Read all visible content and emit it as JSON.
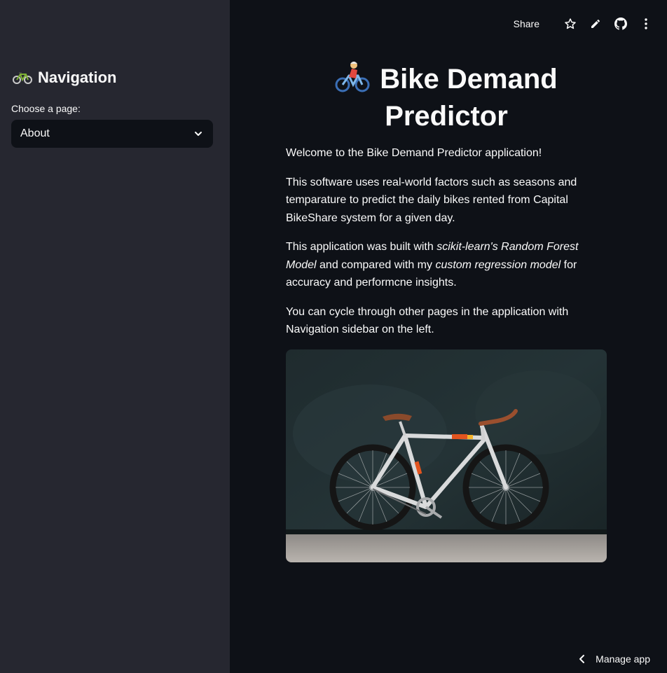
{
  "sidebar": {
    "title": "Navigation",
    "title_icon": "bicycle-icon",
    "select_label": "Choose a page:",
    "select_value": "About"
  },
  "toolbar": {
    "share_label": "Share",
    "icons": [
      "star-icon",
      "pencil-icon",
      "github-icon",
      "more-vertical-icon"
    ]
  },
  "main": {
    "title_icon": "person-biking-icon",
    "title": "Bike Demand Predictor",
    "p1": "Welcome to the Bike Demand Predictor application!",
    "p2": "This software uses real-world factors such as seasons and temparature to predict the daily bikes rented from Capital BikeShare system for a given day.",
    "p3_a": "This application was built with ",
    "p3_em1": "scikit-learn's Random Forest Model",
    "p3_b": " and compared with my ",
    "p3_em2": "custom regression model",
    "p3_c": " for accuracy and performcne insights.",
    "p4": "You can cycle through other pages in the application with Navigation sidebar on the left."
  },
  "footer": {
    "manage_label": "Manage app"
  },
  "colors": {
    "main_bg": "#0e1117",
    "sidebar_bg": "#262730",
    "text": "#fafafa"
  }
}
